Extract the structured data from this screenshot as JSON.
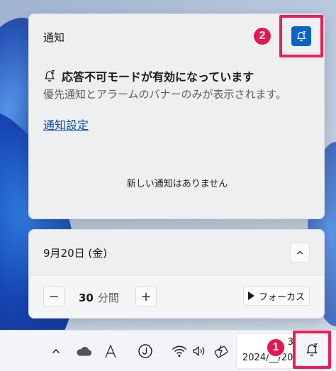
{
  "notifications": {
    "title": "通知",
    "dnd_heading": "応答不可モードが有効になっています",
    "dnd_subtitle": "優先通知とアラームのバナーのみが表示されます。",
    "settings_link": "通知設定",
    "empty_message": "新しい通知はありません",
    "dnd_button_icon": "bell-snooze-icon"
  },
  "calendar": {
    "date_label": "9月20日 (金)",
    "focus": {
      "duration_value": "30",
      "duration_unit": "分間",
      "minus_label": "−",
      "plus_label": "+",
      "focus_button_label": "フォーカス"
    }
  },
  "taskbar": {
    "clock_time": "3",
    "clock_date": "2024/__/20",
    "tray_icons": [
      "chevron-up-icon",
      "onedrive-cloud-icon",
      "ime-a-icon",
      "ime-j-icon",
      "wifi-icon",
      "volume-icon",
      "battery-charging-icon"
    ],
    "bell_icon": "bell-snooze-icon"
  },
  "annotations": {
    "badge_1": "1",
    "badge_2": "2"
  },
  "colors": {
    "accent": "#0b63c5",
    "highlight": "#ef1d57",
    "link": "#0b4da3"
  }
}
